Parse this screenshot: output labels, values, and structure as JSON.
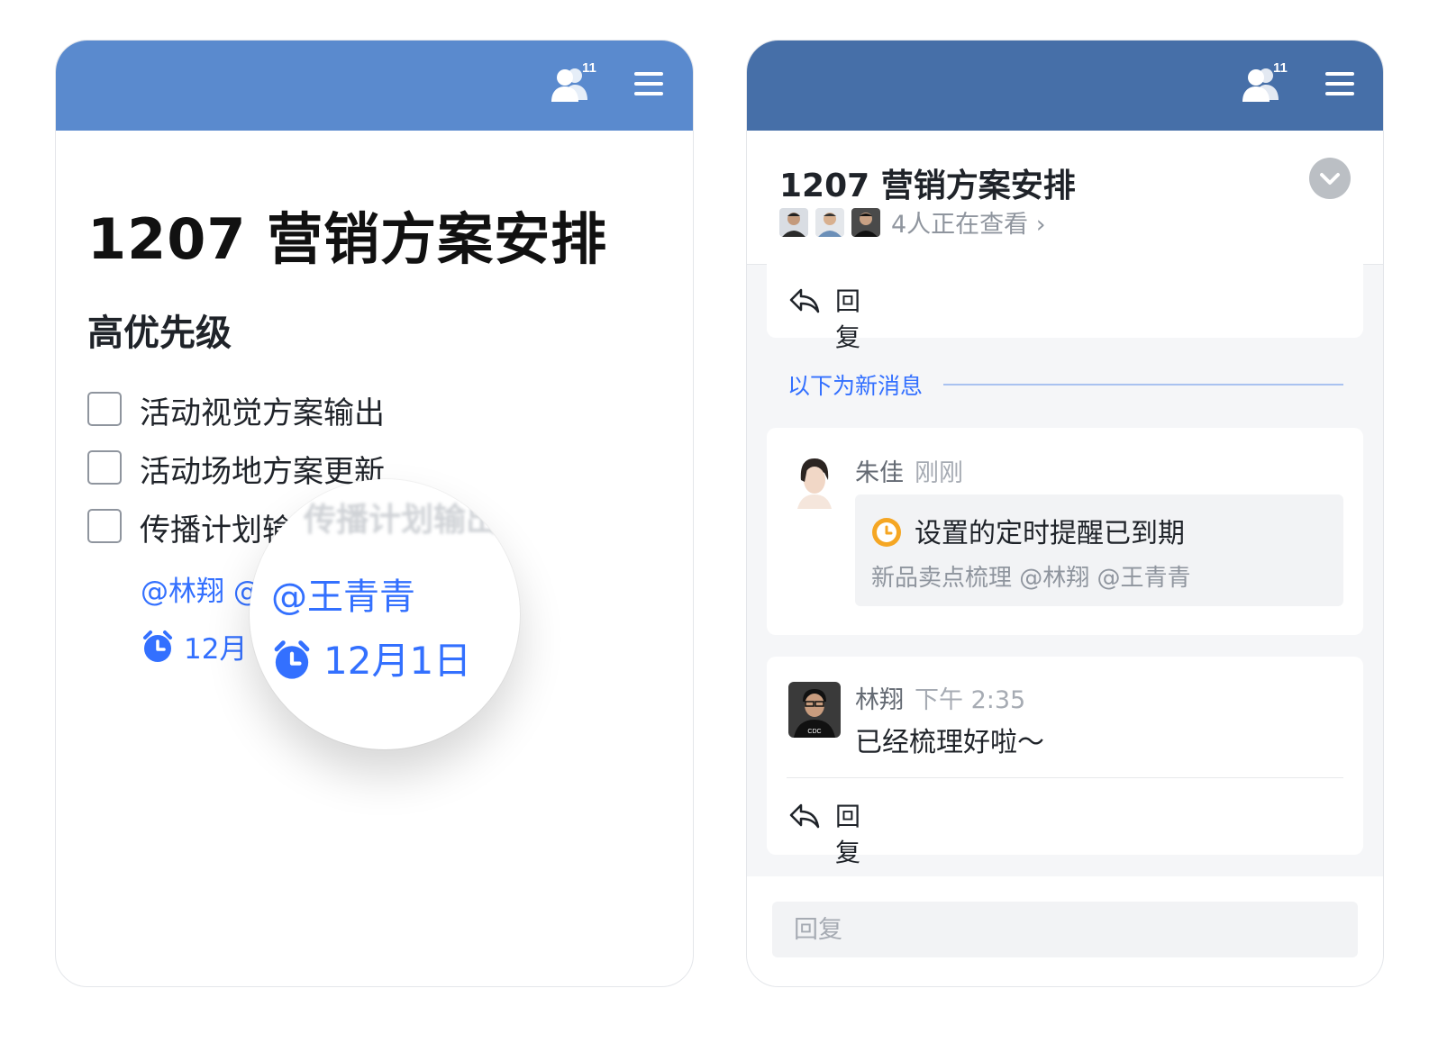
{
  "left_panel": {
    "members_count": "11",
    "doc_title": "1207 营销方案安排",
    "section_title": "高优先级",
    "todos": [
      "活动视觉方案输出",
      "活动场地方案更新",
      "传播计划输"
    ],
    "mention_text": "@林翔 @",
    "date_text": "12月",
    "magnifier": {
      "ghost_text": "传播计划输出",
      "mention": "@王青青",
      "date": "12月1日"
    }
  },
  "right_panel": {
    "members_count": "11",
    "title": "1207 营销方案安排",
    "viewers_text": "4人正在查看 ›",
    "top_reply_label": "回复",
    "new_messages_label": "以下为新消息",
    "messages": [
      {
        "author": "朱佳",
        "time": "刚刚",
        "reminder_title": "设置的定时提醒已到期",
        "reminder_detail": "新品卖点梳理 @林翔 @王青青"
      },
      {
        "author": "林翔",
        "time": "下午 2:35",
        "text": "已经梳理好啦～",
        "reply_label": "回复"
      }
    ],
    "reply_placeholder": "回复"
  },
  "colors": {
    "left_header": "#5a8ace",
    "right_header": "#466fa8",
    "accent_blue": "#3370ff",
    "reminder_orange": "#f5a623"
  },
  "icons": [
    "members-icon",
    "menu-icon",
    "alarm-clock-icon",
    "reply-icon",
    "chevron-down-icon",
    "clock-icon"
  ]
}
